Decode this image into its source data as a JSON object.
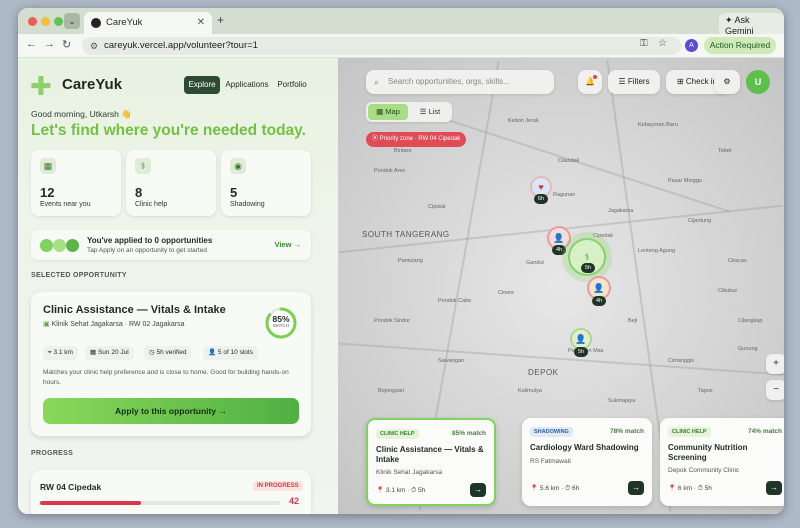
{
  "browser": {
    "tab_title": "CareYuk",
    "url": "careyuk.vercel.app/volunteer?tour=1",
    "ask_gemini": "Ask Gemini",
    "action_required": "Action Required",
    "profile_initial": "A"
  },
  "app": {
    "brand": "CareYuk",
    "nav": [
      "Explore",
      "Applications",
      "Portfolio"
    ],
    "greeting": "Good morning, Utkarsh 👋",
    "headline": "Let's find where you're needed today.",
    "stats": [
      {
        "value": "12",
        "label": "Events near you",
        "icon": "calendar-icon"
      },
      {
        "value": "8",
        "label": "Clinic help",
        "icon": "stethoscope-icon"
      },
      {
        "value": "5",
        "label": "Shadowing",
        "icon": "eye-icon"
      }
    ],
    "applied_title": "You've applied to 0 opportunities",
    "applied_sub": "Tap Apply on an opportunity to get started",
    "view_label": "View →",
    "selected_label": "SELECTED OPPORTUNITY",
    "progress_label": "PROGRESS"
  },
  "selected": {
    "title": "Clinic Assistance — Vitals & Intake",
    "org": "Klinik Sehat Jagakarsa · RW 02 Jagakarsa",
    "match": "85%",
    "match_value": 0.85,
    "match_label": "MATCH",
    "chips": [
      "3.1 km",
      "Sun 20 Jul",
      "5h verified",
      "5 of 10 slots"
    ],
    "description": "Matches your clinic help preference and is close to home. Good for building hands-on hours.",
    "apply": "Apply to this opportunity →"
  },
  "progress": {
    "name": "RW 04 Cipedak",
    "badge": "IN PROGRESS",
    "value": "42",
    "fraction": 0.42
  },
  "map": {
    "search_placeholder": "Search opportunities, orgs, skills...",
    "filters": "Filters",
    "checkin": "Check in",
    "user_initial": "U",
    "view_map": "Map",
    "view_list": "List",
    "priority_zone": "Priority zone · RW 04 Cipedak",
    "labels": {
      "south_tangerang": "SOUTH TANGERANG",
      "depok": "DEPOK",
      "ciputat": "Ciputat",
      "ragunan": "Ragunan",
      "cipedak": "Cipedak",
      "gandul": "Gandul",
      "cinere": "Cinere",
      "pondok_aren": "Pondok Aren",
      "bintaro": "Bintaro",
      "pamulang": "Pamulang",
      "pondok_cabe": "Pondok Cabe",
      "cilandak": "Cilandak",
      "kebayoran": "Kebayoran Baru",
      "jagakarsa": "Jagakarsa",
      "pasar_minggu": "Pasar Minggu",
      "lenteng_agung": "Lenteng Agung",
      "pancoran_mas": "Pancoran Mas",
      "sawangan": "Sawangan",
      "beji": "Beji",
      "cibubur": "Cibubur",
      "kalimulya": "Kalimulya",
      "pondok_sindur": "Pondok Sindur",
      "cimanggis": "Cimanggis",
      "bojongsari": "Bojongsari",
      "cijantung": "Cijantung",
      "sukmajaya": "Sukmajaya",
      "kebon_jeruk": "Kebon Jeruk",
      "tebet": "Tebet",
      "ciracas": "Ciracas",
      "cilangkap": "Cilangkap",
      "tapos": "Tapos",
      "gunung": "Gunung"
    },
    "markers": [
      {
        "tag": "6h",
        "icon": "heart-icon"
      },
      {
        "tag": "4h",
        "icon": "person-icon"
      },
      {
        "tag": "5h",
        "icon": "stethoscope-icon"
      },
      {
        "tag": "4h",
        "icon": "person-icon"
      },
      {
        "tag": "5h",
        "icon": "person-icon"
      }
    ],
    "zoom_in": "+",
    "zoom_out": "−"
  },
  "cards": [
    {
      "badge": "CLINIC HELP",
      "match": "85% match",
      "title": "Clinic Assistance — Vitals & Intake",
      "org": "Klinik Sehat Jagakarsa",
      "meta": "📍 3.1 km · ⏱ 5h"
    },
    {
      "badge": "SHADOWING",
      "match": "78% match",
      "title": "Cardiology Ward Shadowing",
      "org": "RS Fatmawati",
      "meta": "📍 5.6 km · ⏱ 6h"
    },
    {
      "badge": "CLINIC HELP",
      "match": "74% match",
      "title": "Community Nutrition Screening",
      "org": "Depok Community Clinic",
      "meta": "📍 6 km · ⏱ 5h"
    }
  ]
}
